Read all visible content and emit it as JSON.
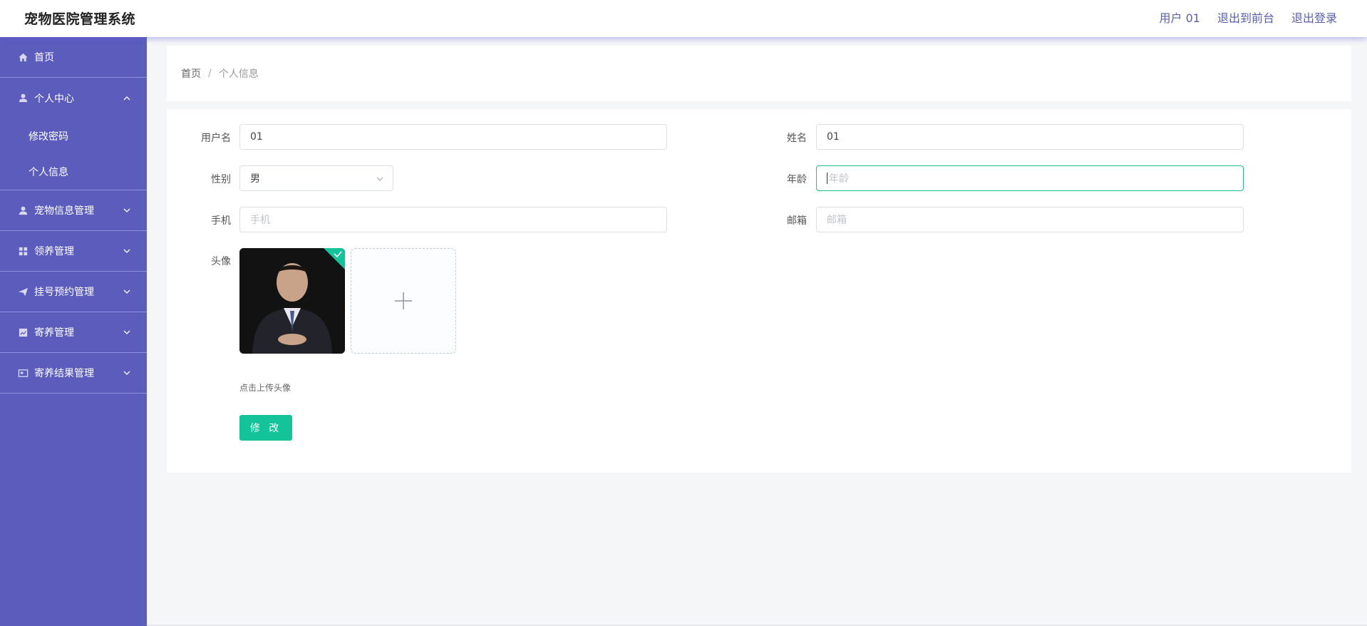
{
  "header": {
    "title": "宠物医院管理系统",
    "user": "用户 01",
    "exit_front": "退出到前台",
    "logout": "退出登录"
  },
  "sidebar": {
    "items": [
      {
        "label": "首页",
        "icon": "home-icon"
      },
      {
        "label": "个人中心",
        "icon": "user-icon",
        "sub": [
          "修改密码",
          "个人信息"
        ]
      },
      {
        "label": "宠物信息管理",
        "icon": "user-icon"
      },
      {
        "label": "领养管理",
        "icon": "grid-icon"
      },
      {
        "label": "挂号预约管理",
        "icon": "send-icon"
      },
      {
        "label": "寄养管理",
        "icon": "chart-icon"
      },
      {
        "label": "寄养结果管理",
        "icon": "card-icon"
      }
    ]
  },
  "breadcrumb": {
    "home": "首页",
    "sep": "/",
    "current": "个人信息"
  },
  "form": {
    "username_label": "用户名",
    "username_value": "01",
    "name_label": "姓名",
    "name_value": "01",
    "gender_label": "性别",
    "gender_value": "男",
    "age_label": "年龄",
    "age_placeholder": "年龄",
    "phone_label": "手机",
    "phone_placeholder": "手机",
    "email_label": "邮箱",
    "email_placeholder": "邮箱",
    "avatar_label": "头像",
    "upload_tip": "点击上传头像",
    "submit": "修 改"
  },
  "colors": {
    "sidebar_bg": "#5c5cbd",
    "accent": "#15c39a",
    "header_link": "#5a5ea8"
  }
}
